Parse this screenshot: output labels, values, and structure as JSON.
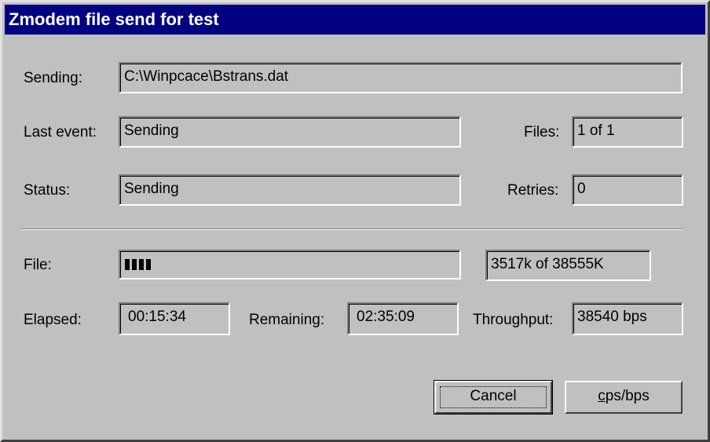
{
  "window": {
    "title": "Zmodem file send for test"
  },
  "sending": {
    "label": "Sending:",
    "value": "C:\\Winpcace\\Bstrans.dat"
  },
  "last_event": {
    "label": "Last event:",
    "value": "Sending"
  },
  "files": {
    "label": "Files:",
    "value": "1 of 1"
  },
  "status": {
    "label": "Status:",
    "value": "Sending"
  },
  "retries": {
    "label": "Retries:",
    "value": "0"
  },
  "file_progress": {
    "label": "File:",
    "progress_blocks": 4,
    "size_text": "3517k of 38555K"
  },
  "elapsed": {
    "label": "Elapsed:",
    "value": "00:15:34"
  },
  "remaining": {
    "label": "Remaining:",
    "value": "02:35:09"
  },
  "throughput": {
    "label": "Throughput:",
    "value": "38540 bps"
  },
  "buttons": {
    "cancel_label": "Cancel",
    "cps_bps_first": "c",
    "cps_bps_rest": "ps/bps"
  },
  "colors": {
    "face": "#c0c0c0",
    "titlebar": "#000080",
    "title_text": "#ffffff"
  }
}
